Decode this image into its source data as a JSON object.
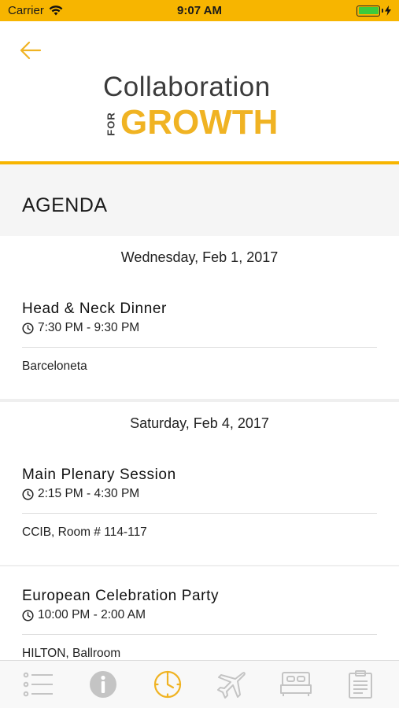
{
  "status_bar": {
    "carrier": "Carrier",
    "time": "9:07 AM",
    "battery_level_fraction": 1.0,
    "accent_color": "#f7b500"
  },
  "header": {
    "back_icon": "arrow-left-icon",
    "logo": {
      "line1": "Collaboration",
      "vertical": "FOR",
      "line2": "GROWTH"
    }
  },
  "section": {
    "title": "AGENDA"
  },
  "agenda": [
    {
      "date": "Wednesday, Feb 1, 2017",
      "events": [
        {
          "title": "Head & Neck Dinner",
          "time": "7:30 PM - 9:30 PM",
          "location": "Barceloneta"
        }
      ]
    },
    {
      "date": "Saturday, Feb 4, 2017",
      "events": [
        {
          "title": "Main Plenary Session",
          "time": "2:15 PM - 4:30 PM",
          "location": "CCIB, Room # 114-117"
        },
        {
          "title": "European Celebration Party",
          "time": "10:00 PM - 2:00 AM",
          "location": "HILTON, Ballroom"
        }
      ]
    }
  ],
  "tab_bar": {
    "active_index": 2,
    "active_color": "#f0b323",
    "inactive_color": "#c4c4c4",
    "tabs": [
      "list-icon",
      "info-icon",
      "clock-icon",
      "airplane-icon",
      "hotel-bed-icon",
      "clipboard-icon"
    ]
  }
}
